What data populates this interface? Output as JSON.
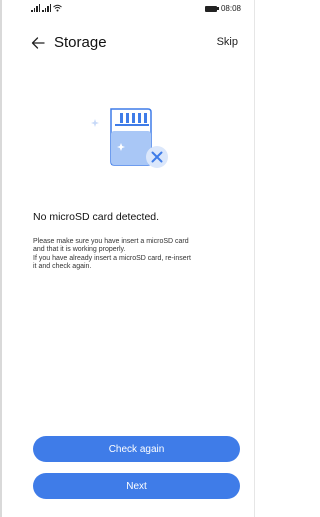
{
  "status_bar": {
    "time": "08:08"
  },
  "header": {
    "title": "Storage",
    "skip_label": "Skip"
  },
  "illustration": {
    "card_color": "#3f7ce8",
    "accent_color": "#cfe0fb"
  },
  "message": {
    "title": "No microSD card detected.",
    "line1": "Please make sure you have insert a microSD card",
    "line2": "and that it is working properly.",
    "line3": "If you have already insert a microSD card, re-insert",
    "line4": "it and check again."
  },
  "buttons": {
    "check_again_label": "Check again",
    "next_label": "Next"
  },
  "colors": {
    "primary": "#3f7ce8"
  }
}
